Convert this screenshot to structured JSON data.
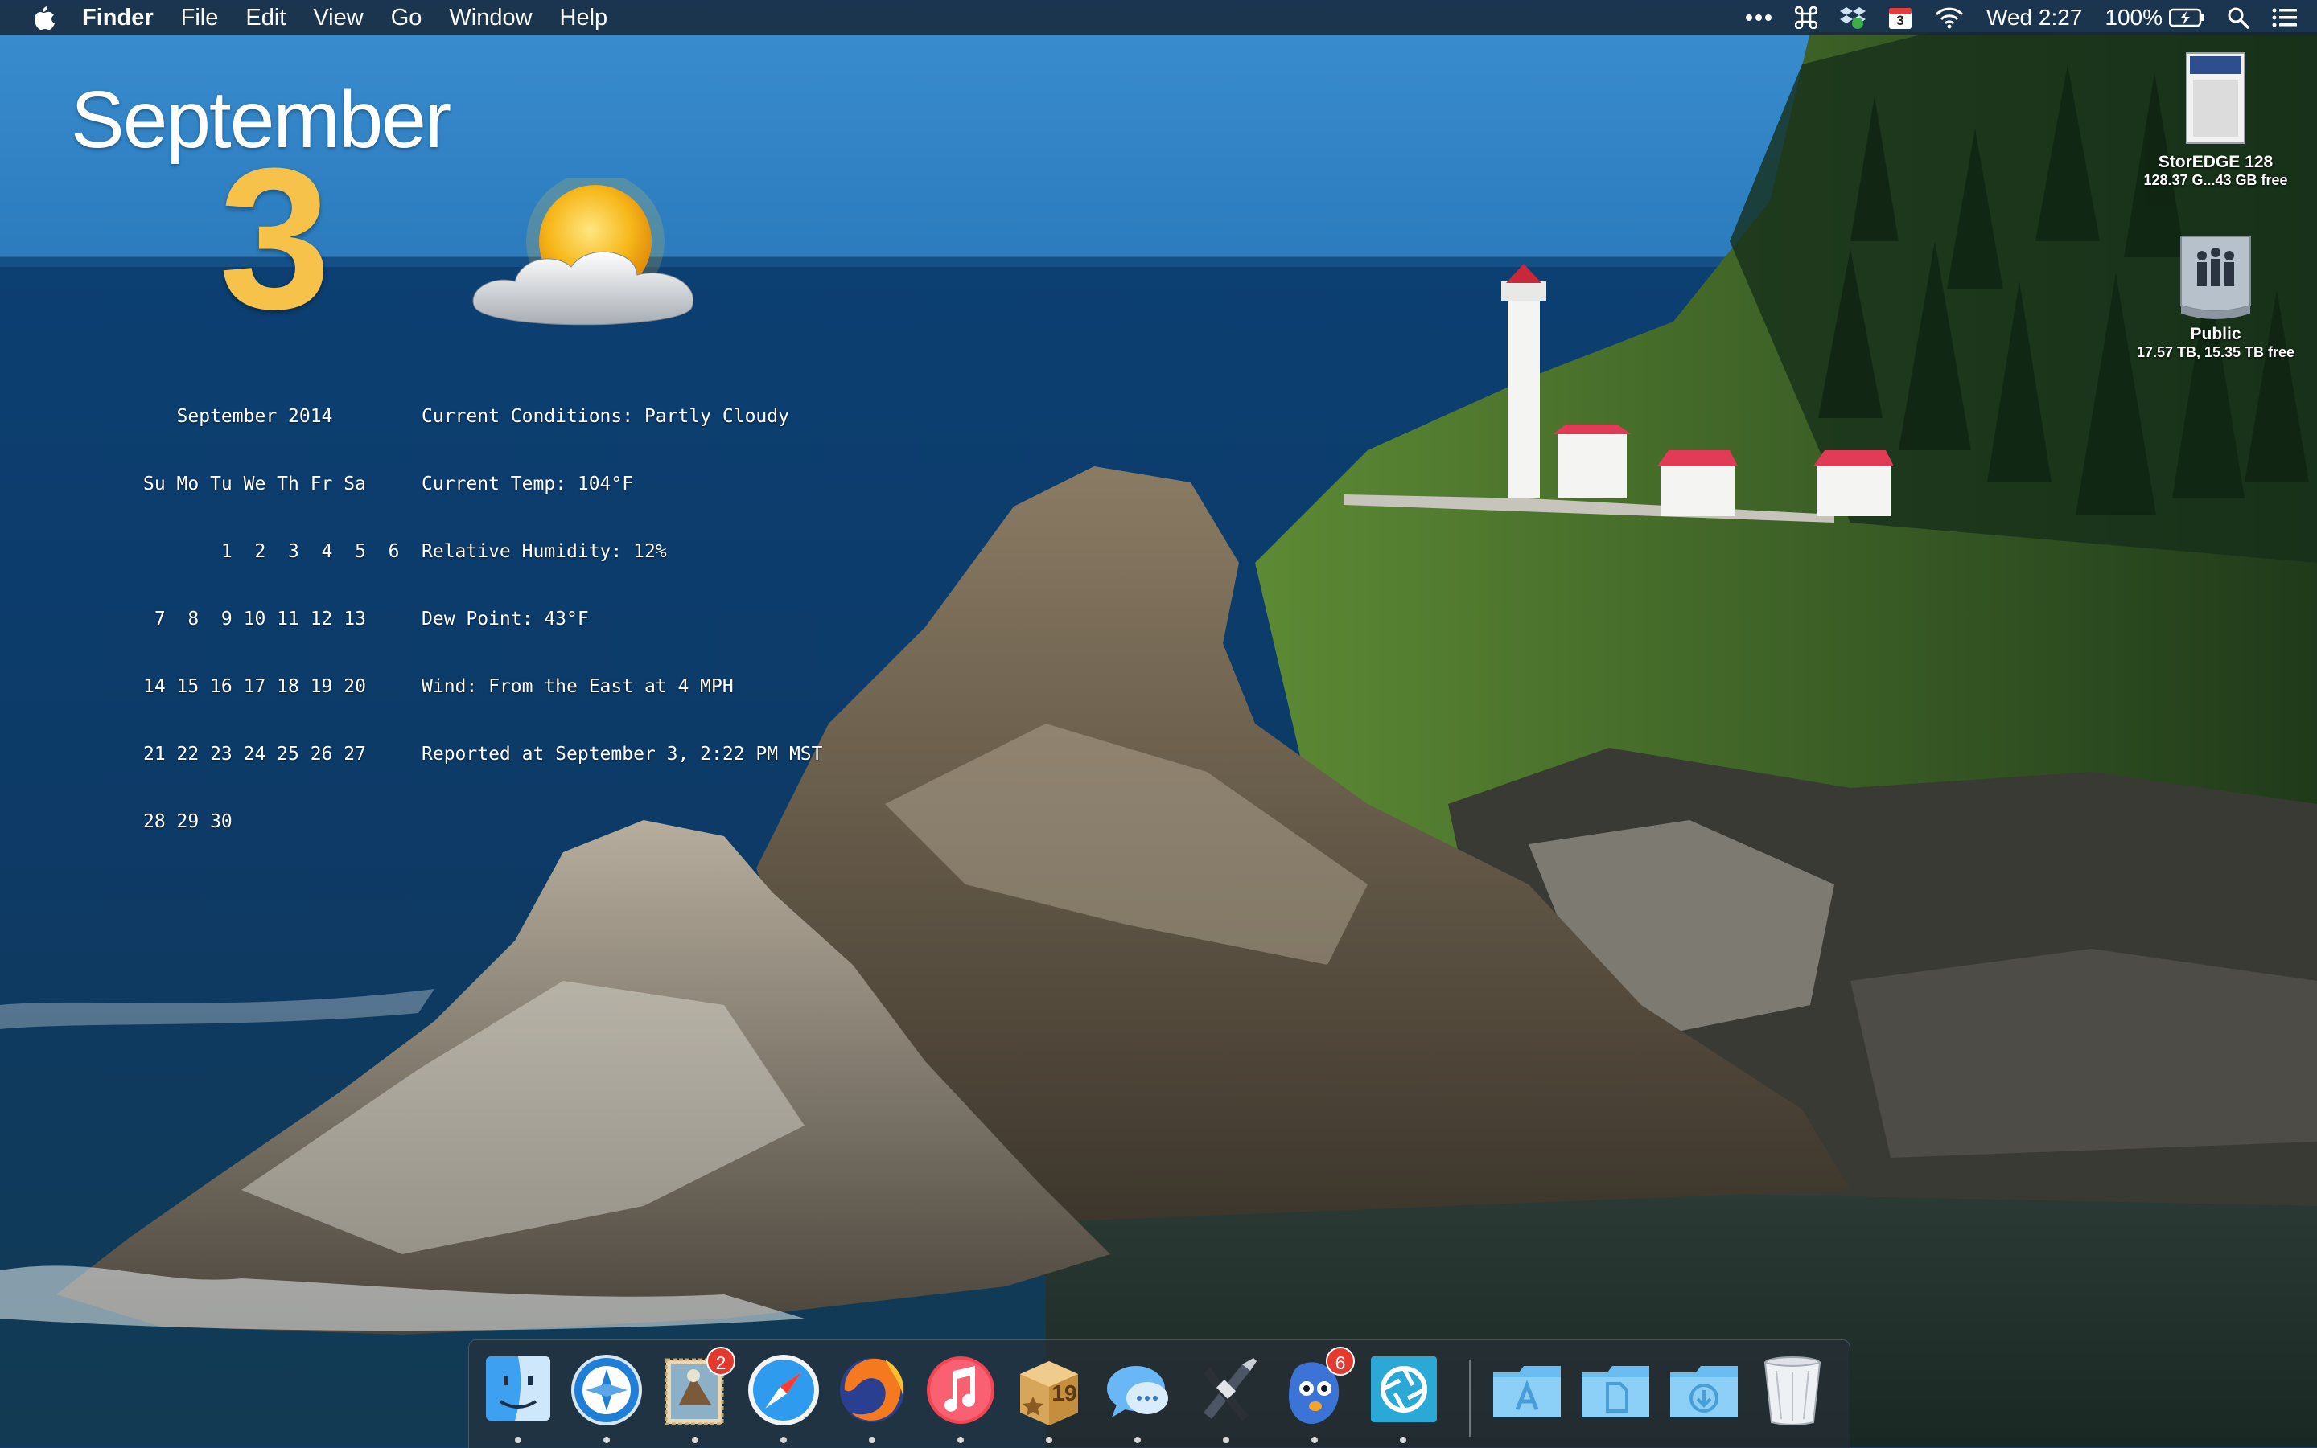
{
  "menubar": {
    "app_name": "Finder",
    "items": [
      "File",
      "Edit",
      "View",
      "Go",
      "Window",
      "Help"
    ],
    "calendar_icon_day": "3",
    "clock": "Wed 2:27",
    "battery_percent": "100%"
  },
  "widget": {
    "month": "September",
    "day": "3",
    "weather_icon": "partly-cloudy-icon",
    "calendar_lines": [
      "   September 2014",
      "Su Mo Tu We Th Fr Sa",
      "       1  2  3  4  5  6",
      " 7  8  9 10 11 12 13",
      "14 15 16 17 18 19 20",
      "21 22 23 24 25 26 27",
      "28 29 30"
    ],
    "conditions": [
      "Current Conditions: Partly Cloudy",
      "Current Temp: 104°F",
      "Relative Humidity: 12%",
      "Dew Point: 43°F",
      "Wind: From the East at 4 MPH",
      "Reported at September 3, 2:22 PM MST"
    ]
  },
  "desktop_icons": [
    {
      "name": "StorEDGE 128",
      "info": "128.37 G...43 GB free",
      "icon": "sd-card-drive-icon"
    },
    {
      "name": "Public",
      "info": "17.57 TB, 15.35 TB free",
      "icon": "network-share-icon"
    }
  ],
  "dock": {
    "apps": [
      {
        "name": "Finder",
        "icon": "finder-icon"
      },
      {
        "name": "Navigator",
        "icon": "compass-icon"
      },
      {
        "name": "Mail",
        "icon": "mail-icon",
        "badge": "2"
      },
      {
        "name": "Safari",
        "icon": "safari-icon"
      },
      {
        "name": "Firefox",
        "icon": "firefox-icon"
      },
      {
        "name": "iTunes",
        "icon": "itunes-icon"
      },
      {
        "name": "Fantastical",
        "icon": "calendar-box-icon",
        "box_day": "19"
      },
      {
        "name": "Messages",
        "icon": "messages-icon"
      },
      {
        "name": "Pixelmator",
        "icon": "tools-icon"
      },
      {
        "name": "Tweetbot",
        "icon": "tweetbot-icon",
        "badge": "6"
      },
      {
        "name": "Aperture",
        "icon": "aperture-icon"
      }
    ],
    "folders": [
      {
        "name": "Applications",
        "icon": "applications-folder-icon"
      },
      {
        "name": "Documents",
        "icon": "documents-folder-icon"
      },
      {
        "name": "Downloads",
        "icon": "downloads-folder-icon"
      }
    ],
    "trash": {
      "name": "Trash",
      "icon": "trash-icon"
    }
  },
  "colors": {
    "sky": "#2d7fc2",
    "ocean": "#0c3d6b",
    "day_number": "#f6c24a",
    "badge": "#e3392f"
  }
}
